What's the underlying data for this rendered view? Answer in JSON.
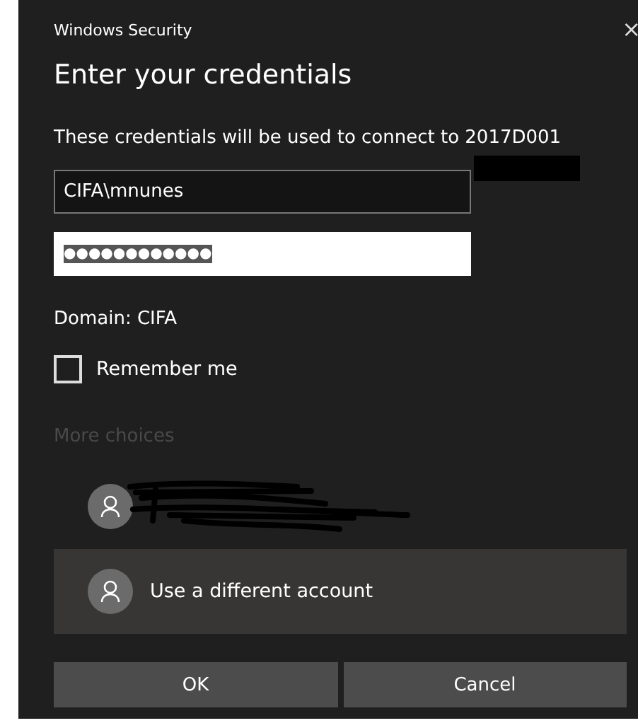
{
  "window": {
    "title": "Windows Security",
    "close": "×"
  },
  "heading": "Enter your credentials",
  "message": "These credentials will be used to connect to 2017D001",
  "fields": [
    {
      "kind": "text",
      "value": "CIFA\\mnunes",
      "focused": false,
      "text_selected": false
    },
    {
      "kind": "password",
      "value": "●●●●●●●●●●●●",
      "focused": true,
      "text_selected": true
    }
  ],
  "domain": "Domain: CIFA",
  "remember_me": {
    "label": "Remember me",
    "checked": false
  },
  "more_choices": {
    "label": "More choices",
    "disabled": true
  },
  "accounts": [
    {
      "kind": "redacted",
      "selected": false
    },
    {
      "kind": "other",
      "label": "Use a different account",
      "selected": true
    }
  ],
  "buttons": [
    {
      "label": "OK"
    },
    {
      "label": "Cancel"
    }
  ]
}
